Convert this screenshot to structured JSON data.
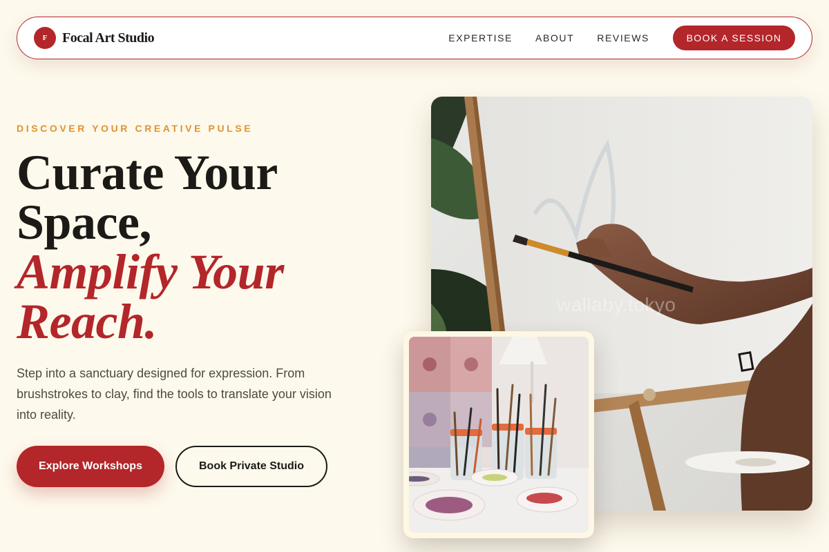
{
  "nav": {
    "brand_initial": "F",
    "brand_name": "Focal Art Studio",
    "links": [
      "EXPERTISE",
      "ABOUT",
      "REVIEWS"
    ],
    "cta": "BOOK A SESSION"
  },
  "hero": {
    "eyebrow": "DISCOVER YOUR CREATIVE PULSE",
    "headline_line1": "Curate Your",
    "headline_line2": "Space,",
    "headline_accent1": "Amplify Your",
    "headline_accent2": "Reach.",
    "description": "Step into a sanctuary designed for expression. From brushstrokes to clay, find the tools to translate your vision into reality.",
    "primary_button": "Explore Workshops",
    "secondary_button": "Book Private Studio"
  },
  "images": {
    "main": "photo-artist-painting-canvas-on-easel",
    "inset": "photo-jars-of-paintbrushes-and-paint-palettes",
    "watermark": "wallaby.tokyo"
  },
  "colors": {
    "background": "#fdf9ec",
    "accent": "#b3262a",
    "eyebrow": "#e0922f",
    "text": "#1c1a17"
  }
}
